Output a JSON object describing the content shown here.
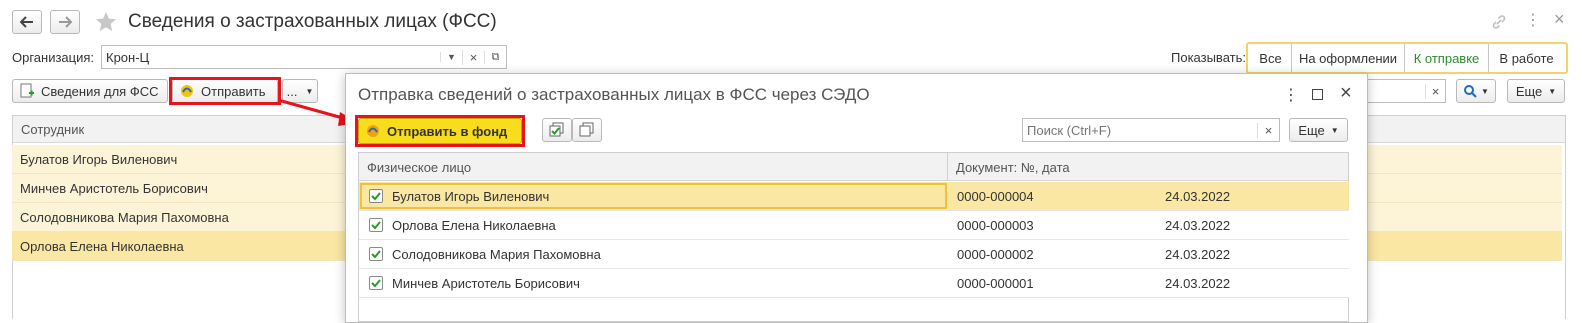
{
  "window": {
    "title": "Сведения о застрахованных лицах (ФСС)"
  },
  "org": {
    "label": "Организация:",
    "value": "Крон-Ц"
  },
  "show": {
    "label": "Показывать:",
    "options": [
      "Все",
      "На оформлении",
      "К отправке",
      "В работе"
    ],
    "selected": "К отправке"
  },
  "toolbar": {
    "fss_label": "Сведения для ФСС",
    "send_label": "Отправить",
    "more_label": "...",
    "more_right_label": "Еще"
  },
  "list": {
    "header": "Сотрудник",
    "rows": [
      "Булатов Игорь Виленович",
      "Минчев Аристотель Борисович",
      "Солодовникова Мария Пахомовна",
      "Орлова Елена Николаевна"
    ]
  },
  "dialog": {
    "title": "Отправка сведений о застрахованных лицах в ФСС через СЭДО",
    "send_label": "Отправить в фонд",
    "search_placeholder": "Поиск (Ctrl+F)",
    "more_label": "Еще",
    "columns": {
      "person": "Физическое лицо",
      "document": "Документ: №, дата"
    },
    "rows": [
      {
        "person": "Булатов Игорь Виленович",
        "number": "0000-000004",
        "date": "24.03.2022",
        "checked": true
      },
      {
        "person": "Орлова Елена Николаевна",
        "number": "0000-000003",
        "date": "24.03.2022",
        "checked": true
      },
      {
        "person": "Солодовникова Мария Пахомовна",
        "number": "0000-000002",
        "date": "24.03.2022",
        "checked": true
      },
      {
        "person": "Минчев Аристотель Борисович",
        "number": "0000-000001",
        "date": "24.03.2022",
        "checked": true
      }
    ]
  },
  "colors": {
    "highlight_red": "#e8141b",
    "selected_row": "#fbe7a4",
    "row_bg": "#fdf4d8",
    "filter_border": "#f3d26a",
    "filter_active_text": "#2b8a2b",
    "send_button": "#f8dd1c"
  }
}
